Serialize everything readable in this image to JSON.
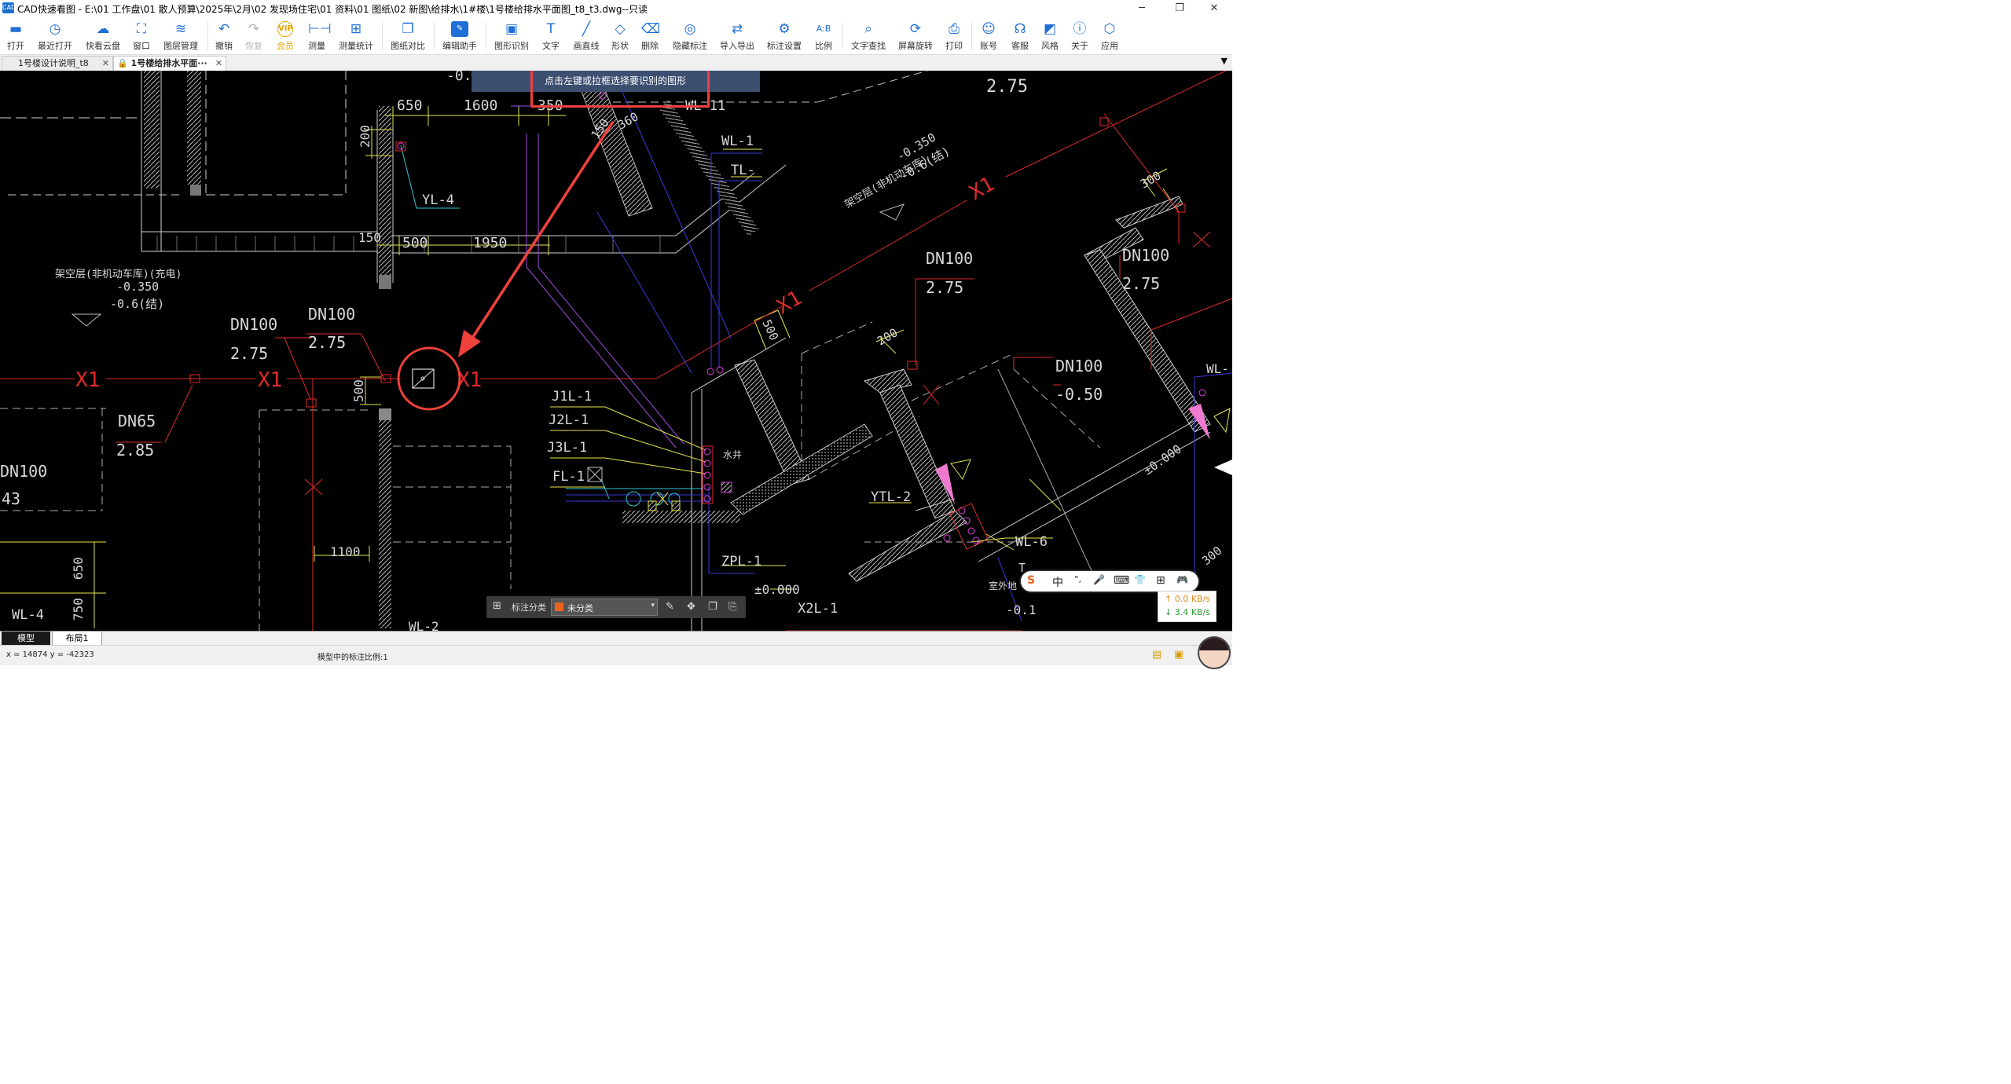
{
  "window": {
    "app_icon": "CAD",
    "title": "CAD快速看图 - E:\\01 工作盘\\01 散人预算\\2025年\\2月\\02 发现场住宅\\01 资料\\01 图纸\\02 新图\\给排水\\1#楼\\1号楼给排水平面图_t8_t3.dwg--只读",
    "minimize": "─",
    "maximize": "❐",
    "close": "✕"
  },
  "toolbar": [
    {
      "label": "打开",
      "icon": "folder-open-icon",
      "glyph": "▬"
    },
    {
      "label": "最近打开",
      "icon": "clock-icon",
      "glyph": "◷"
    },
    {
      "label": "快看云盘",
      "icon": "cloud-icon",
      "glyph": "☁"
    },
    {
      "label": "窗口",
      "icon": "window-icon",
      "glyph": "⛶"
    },
    {
      "label": "图层管理",
      "icon": "layers-icon",
      "glyph": "≋"
    },
    {
      "label": "撤销",
      "icon": "undo-icon",
      "glyph": "↶"
    },
    {
      "label": "恢复",
      "icon": "redo-icon",
      "glyph": "↷"
    },
    {
      "label": "会员",
      "icon": "vip-icon",
      "glyph": "VIP"
    },
    {
      "label": "测量",
      "icon": "ruler-icon",
      "glyph": "⊢⊣"
    },
    {
      "label": "测量统计",
      "icon": "measure-stats-icon",
      "glyph": "⊞"
    },
    {
      "label": "图纸对比",
      "icon": "compare-icon",
      "glyph": "❐"
    },
    {
      "label": "编辑助手",
      "icon": "edit-assistant-icon",
      "glyph": "✎"
    },
    {
      "label": "图形识别",
      "icon": "shape-recognition-icon",
      "glyph": "▣"
    },
    {
      "label": "文字",
      "icon": "text-icon",
      "glyph": "T"
    },
    {
      "label": "画直线",
      "icon": "line-icon",
      "glyph": "╱"
    },
    {
      "label": "形状",
      "icon": "shape-icon",
      "glyph": "◇"
    },
    {
      "label": "删除",
      "icon": "eraser-icon",
      "glyph": "⌫"
    },
    {
      "label": "隐藏标注",
      "icon": "hide-annotation-icon",
      "glyph": "◎"
    },
    {
      "label": "导入导出",
      "icon": "import-export-icon",
      "glyph": "⇄"
    },
    {
      "label": "标注设置",
      "icon": "annotation-settings-icon",
      "glyph": "⚙"
    },
    {
      "label": "比例",
      "icon": "scale-icon",
      "glyph": "A:B"
    },
    {
      "label": "文字查找",
      "icon": "text-search-icon",
      "glyph": "⌕"
    },
    {
      "label": "屏幕旋转",
      "icon": "rotate-screen-icon",
      "glyph": "⟳"
    },
    {
      "label": "打印",
      "icon": "printer-icon",
      "glyph": "⎙"
    },
    {
      "label": "账号",
      "icon": "account-icon",
      "glyph": "☺"
    },
    {
      "label": "客服",
      "icon": "headset-icon",
      "glyph": "☊"
    },
    {
      "label": "风格",
      "icon": "style-icon",
      "glyph": "◩"
    },
    {
      "label": "关于",
      "icon": "info-icon",
      "glyph": "ⓘ"
    },
    {
      "label": "应用",
      "icon": "apps-icon",
      "glyph": "⬡"
    }
  ],
  "tabs": [
    {
      "label": "1号楼设计说明_t8",
      "close": "✕"
    },
    {
      "label": "1号楼给排水平面···",
      "close": "✕"
    }
  ],
  "tab_menu": "▼",
  "hint": "点击左键或拉框选择要识别的图形",
  "drawing_labels": {
    "wl11": "WL-11",
    "wl1": "WL-1",
    "tl": "TL-",
    "yl4": "YL-4",
    "d650": "650",
    "d1600": "1600",
    "d350": "350",
    "d360": "360",
    "d150a": "150",
    "d200a": "200",
    "d150b": "150",
    "d500a": "500",
    "d1950": "1950",
    "d500b": "500",
    "d200b": "200",
    "d500c": "500",
    "d300a": "300",
    "room1": "架空层(非机动车库)(充电)",
    "lvl1": "-0.350",
    "lvl2": "-0.6(结)",
    "room2": "架空层(非机动车库)",
    "lvl3": "-0.350",
    "lvl4": "-0.6(结)",
    "dn100a": "DN100",
    "v275a": "2.75",
    "dn100b": "DN100",
    "v275b": "2.75",
    "dn100c": "DN100",
    "v275c": "2.75",
    "dn100d": "DN100",
    "v275d": "2.75",
    "dn65": "DN65",
    "v285": "2.85",
    "dn100e": "DN100",
    "v43": "43",
    "dn100f": "DN100",
    "vm050": "-0.50",
    "v275top": "2.75",
    "vtop": "-0.",
    "x1a": "X1",
    "x1b": "X1",
    "x1c": "X1",
    "x1d": "X1",
    "x1e": "X1",
    "j1l1": "J1L-1",
    "j2l1": "J2L-1",
    "j3l1": "J3L-1",
    "fl1": "FL-1",
    "shuijing": "水井",
    "zpl1": "ZPL-1",
    "pm000": "±0.000",
    "x2l1": "X2L-1",
    "wl2": "WL-2",
    "wl4": "WL-4",
    "d650b": "650",
    "d750": "750",
    "d1100": "1100",
    "ytl2": "YTL-2",
    "wl6": "WL-6",
    "t": "T",
    "m01": "-0.1",
    "outdoor": "室外地",
    "pm000b": "±0.000",
    "wlr": "WL-",
    "d300b": "300"
  },
  "annotation_bar": {
    "grid_icon": "⊞",
    "label": "标注分类",
    "selected": "未分类",
    "swatch_color": "#e8641e",
    "dropdown": "▾",
    "edit_icon": "✎",
    "move_icon": "✥",
    "copy_icon": "❐",
    "paste_icon": "⎘"
  },
  "ime": {
    "logo": "S",
    "mode": "中",
    "punct": "°,",
    "mic": "🎤",
    "keyboard": "⌨",
    "skin": "👕",
    "apps": "⊞",
    "game": "🎮"
  },
  "network": {
    "up": "↑ 0.0 KB/s",
    "down": "↓ 3.4 KB/s"
  },
  "layout_tabs": [
    "模型",
    "布局1"
  ],
  "status": {
    "coords": "x = 14874  y = -42323",
    "scale": "模型中的标注比例:1"
  },
  "colors": {
    "accent": "#1f6fd6",
    "annotation_red": "#f0413c",
    "hint_bg": "#3c4f70"
  }
}
